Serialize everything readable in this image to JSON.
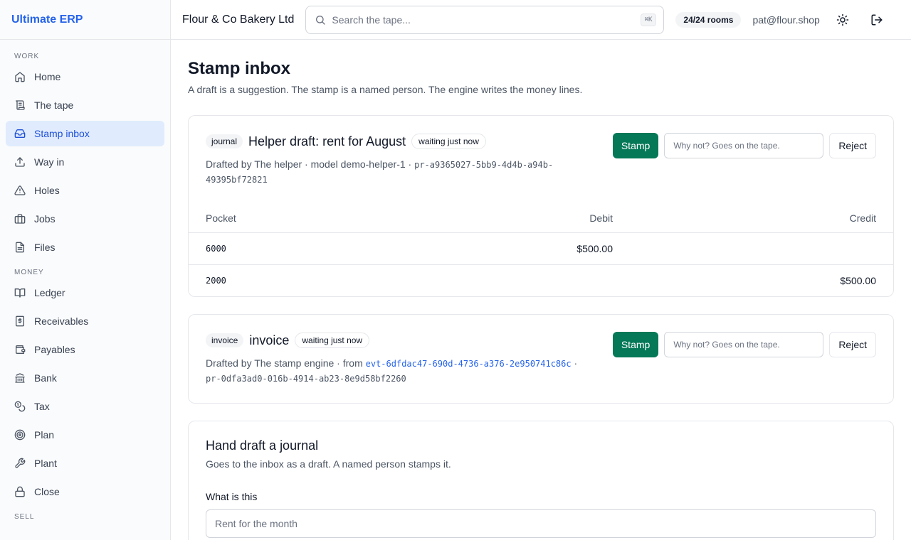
{
  "brand": "Ultimate ERP",
  "sidebar": {
    "sections": [
      {
        "label": "Work",
        "items": [
          {
            "label": "Home",
            "icon": "home-icon"
          },
          {
            "label": "The tape",
            "icon": "scroll-icon"
          },
          {
            "label": "Stamp inbox",
            "icon": "inbox-icon",
            "active": true
          },
          {
            "label": "Way in",
            "icon": "upload-icon"
          },
          {
            "label": "Holes",
            "icon": "warning-icon"
          },
          {
            "label": "Jobs",
            "icon": "briefcase-icon"
          },
          {
            "label": "Files",
            "icon": "file-icon"
          }
        ]
      },
      {
        "label": "Money",
        "items": [
          {
            "label": "Ledger",
            "icon": "book-icon"
          },
          {
            "label": "Receivables",
            "icon": "receipt-icon"
          },
          {
            "label": "Payables",
            "icon": "wallet-icon"
          },
          {
            "label": "Bank",
            "icon": "bank-icon"
          },
          {
            "label": "Tax",
            "icon": "coins-icon"
          },
          {
            "label": "Plan",
            "icon": "target-icon"
          },
          {
            "label": "Plant",
            "icon": "wrench-icon"
          },
          {
            "label": "Close",
            "icon": "lock-icon"
          }
        ]
      },
      {
        "label": "Sell",
        "items": []
      }
    ]
  },
  "topbar": {
    "company": "Flour & Co Bakery Ltd",
    "search_placeholder": "Search the tape...",
    "search_shortcut": "⌘K",
    "rooms": "24/24 rooms",
    "email": "pat@flour.shop"
  },
  "page": {
    "title": "Stamp inbox",
    "subtitle": "A draft is a suggestion. The stamp is a named person. The engine writes the money lines."
  },
  "drafts": [
    {
      "kind": "journal",
      "title": "Helper draft: rent for August",
      "status": "waiting just now",
      "meta_text": "Drafted by The helper · model demo-helper-1 ·",
      "meta_code": "pr-a9365027-5bb9-4d4b-a94b-49395bf72821",
      "stamp_label": "Stamp",
      "reason_placeholder": "Why not? Goes on the tape.",
      "reject_label": "Reject",
      "columns": [
        "Pocket",
        "Debit",
        "Credit"
      ],
      "lines": [
        {
          "pocket": "6000",
          "debit": "$500.00",
          "credit": ""
        },
        {
          "pocket": "2000",
          "debit": "",
          "credit": "$500.00"
        }
      ]
    },
    {
      "kind": "invoice",
      "title": "invoice",
      "status": "waiting just now",
      "meta_text": "Drafted by The stamp engine · from",
      "meta_link": "evt-6dfdac47-690d-4736-a376-2e950741c86c",
      "meta_sep": "·",
      "meta_code": "pr-0dfa3ad0-016b-4914-ab23-8e9d58bf2260",
      "stamp_label": "Stamp",
      "reason_placeholder": "Why not? Goes on the tape.",
      "reject_label": "Reject"
    }
  ],
  "hand_draft": {
    "title": "Hand draft a journal",
    "subtitle": "Goes to the inbox as a draft. A named person stamps it.",
    "field_label": "What is this",
    "field_placeholder": "Rent for the month"
  },
  "colors": {
    "accent": "#2563eb",
    "active_bg": "#e0ecfd",
    "stamp": "#047857"
  }
}
